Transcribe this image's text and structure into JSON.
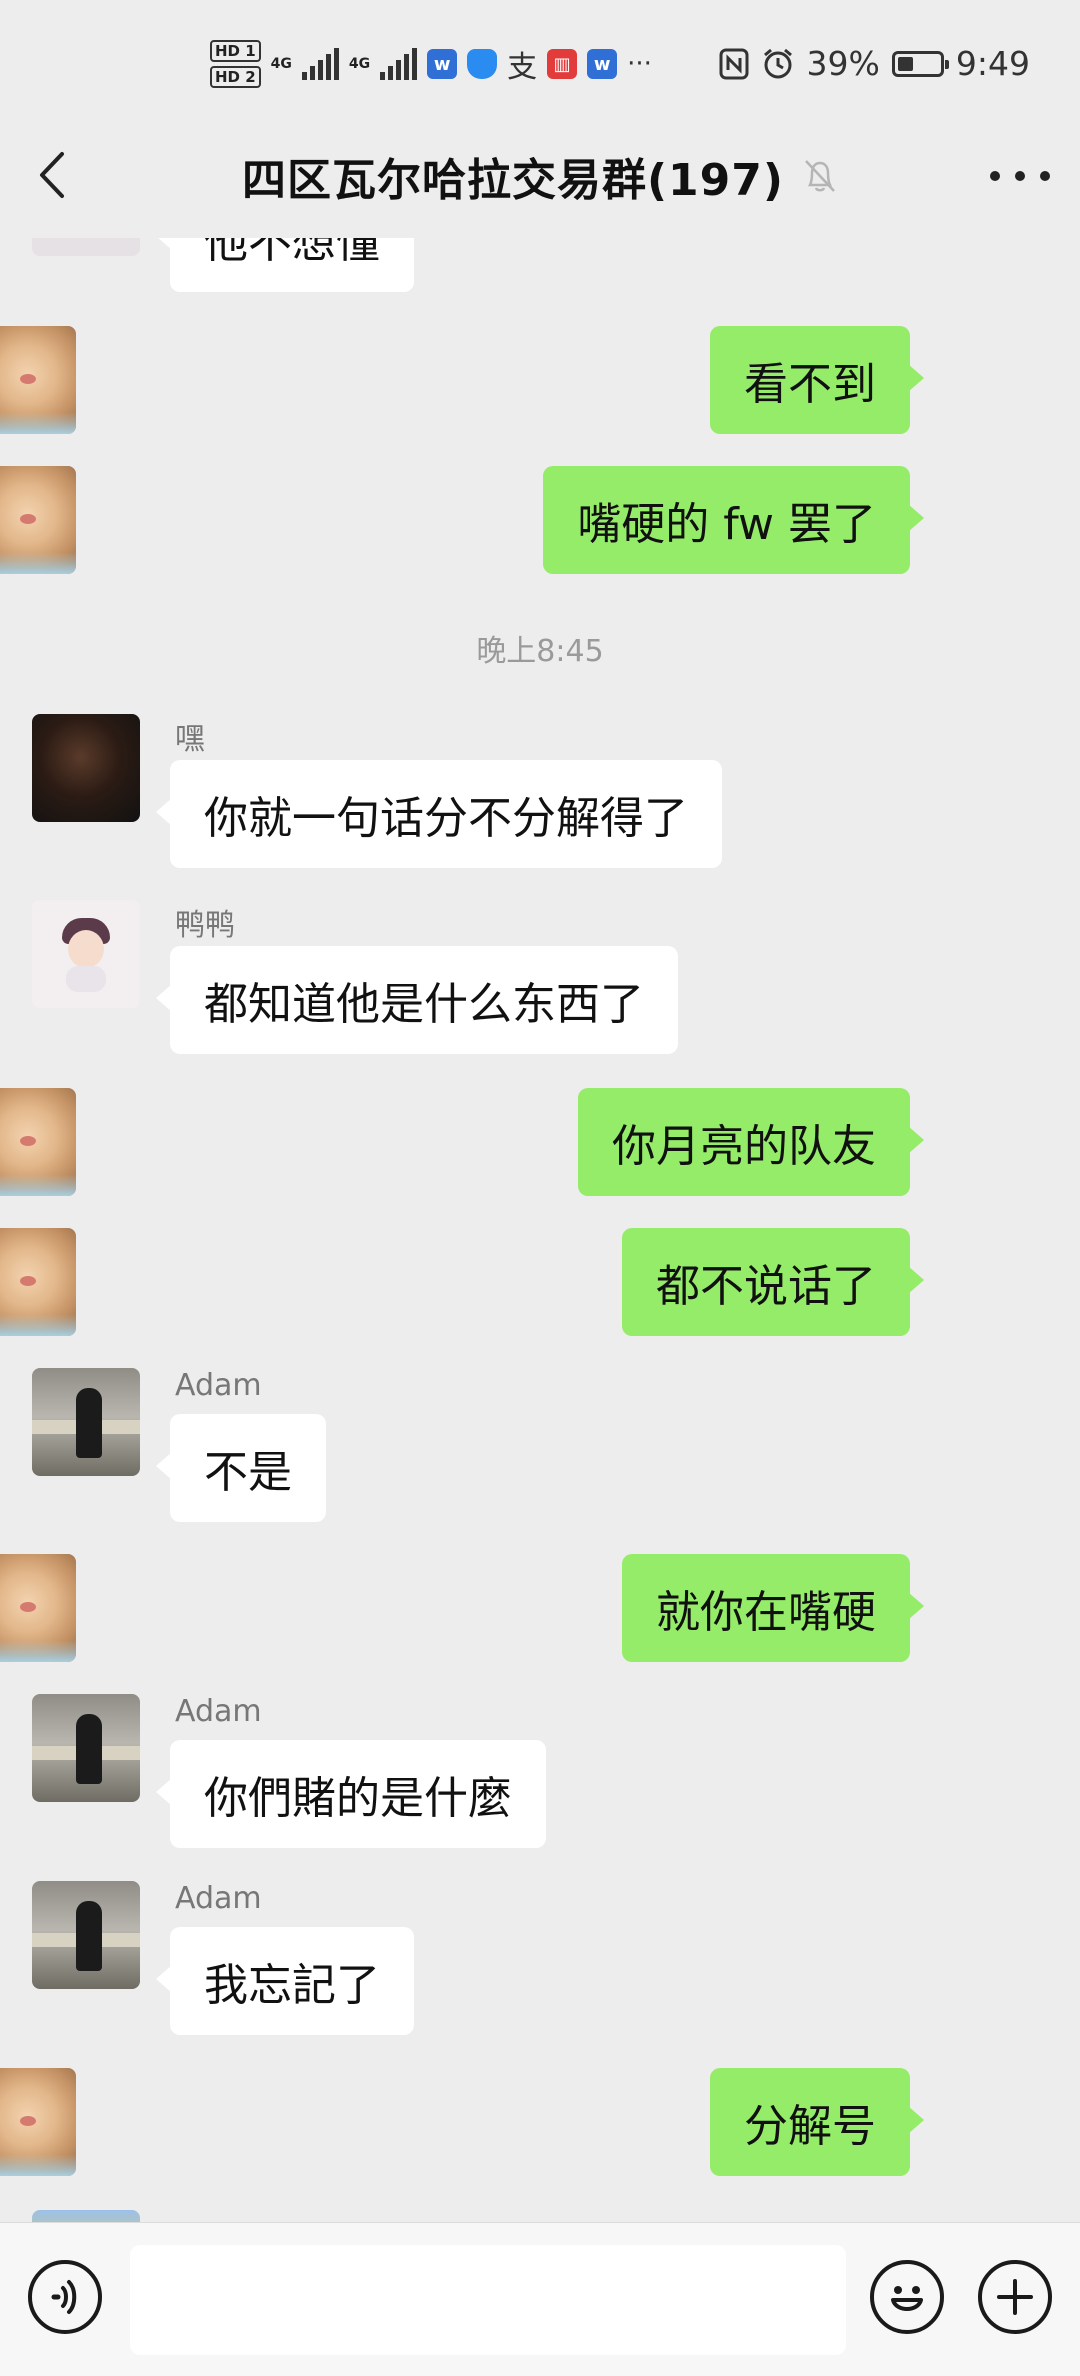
{
  "status_bar": {
    "hd1": "HD 1",
    "hd2": "HD 2",
    "net1": "4G",
    "net2": "4G",
    "more": "···",
    "battery_text": "39%",
    "battery_level_percent": 39,
    "time": "9:49"
  },
  "header": {
    "title": "四区瓦尔哈拉交易群(197)",
    "muted": true
  },
  "messages": [
    {
      "side": "in",
      "sender": "",
      "text": "他不想懂",
      "partial": true
    },
    {
      "side": "out",
      "text": "看不到"
    },
    {
      "side": "out",
      "text": "嘴硬的 fw 罢了"
    },
    {
      "timestamp": "晚上8:45"
    },
    {
      "side": "in",
      "sender": "嘿",
      "text": "你就一句话分不分解得了"
    },
    {
      "side": "in",
      "sender": "鸭鸭",
      "text": "都知道他是什么东西了"
    },
    {
      "side": "out",
      "text": "你月亮的队友"
    },
    {
      "side": "out",
      "text": "都不说话了"
    },
    {
      "side": "in",
      "sender": "Adam",
      "text": "不是"
    },
    {
      "side": "out",
      "text": "就你在嘴硬"
    },
    {
      "side": "in",
      "sender": "Adam",
      "text": "你們賭的是什麼"
    },
    {
      "side": "in",
      "sender": "Adam",
      "text": "我忘記了"
    },
    {
      "side": "out",
      "text": "分解号"
    }
  ],
  "input_bar": {
    "placeholder": ""
  },
  "icons": {
    "back": "chevron-left-icon",
    "mute": "bell-off-icon",
    "more": "more-dots-icon",
    "voice": "voice-icon",
    "emoji": "emoji-icon",
    "plus": "plus-icon"
  }
}
